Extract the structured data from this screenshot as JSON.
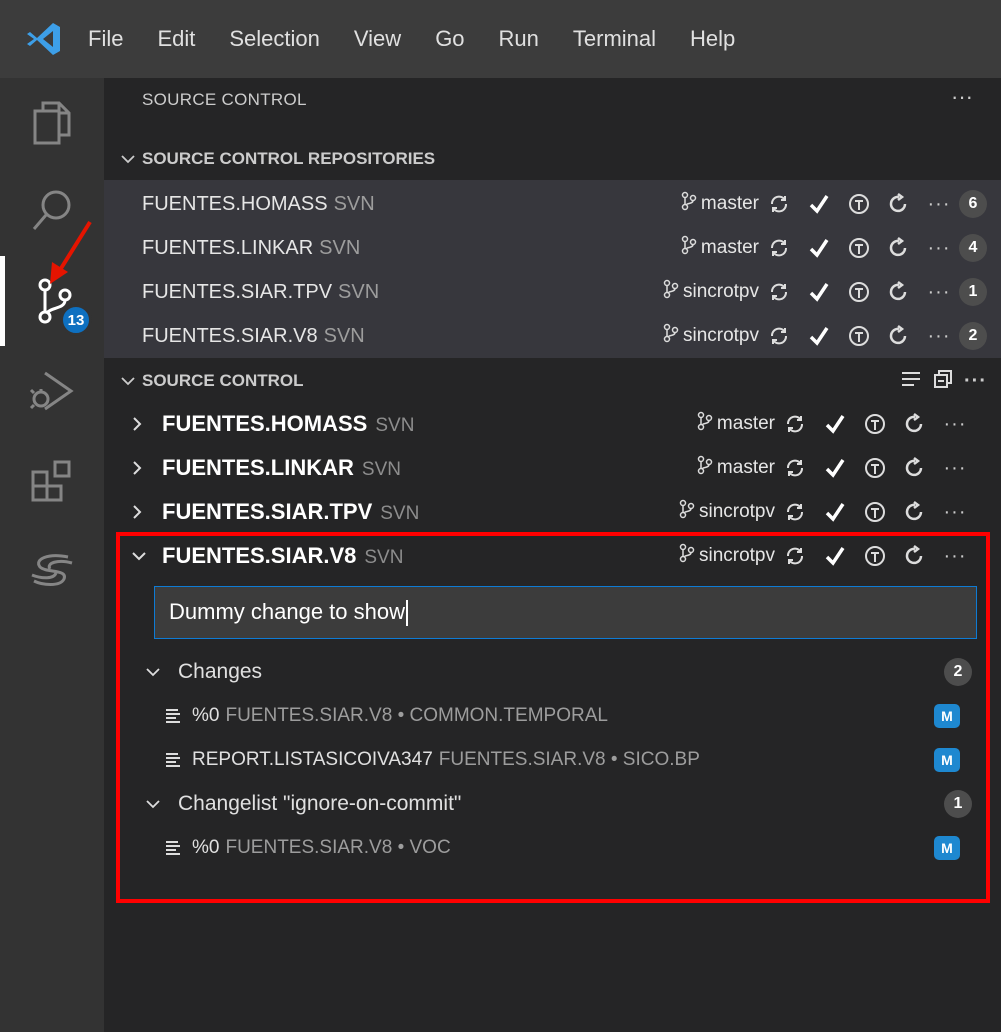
{
  "menu": [
    "File",
    "Edit",
    "Selection",
    "View",
    "Go",
    "Run",
    "Terminal",
    "Help"
  ],
  "activity": {
    "scm_badge": "13"
  },
  "sidebar": {
    "title": "SOURCE CONTROL",
    "more": "···",
    "repositories_header": "SOURCE CONTROL REPOSITORIES",
    "repositories": [
      {
        "name": "FUENTES.HOMASS",
        "type": "SVN",
        "branch": "master",
        "count": "6"
      },
      {
        "name": "FUENTES.LINKAR",
        "type": "SVN",
        "branch": "master",
        "count": "4"
      },
      {
        "name": "FUENTES.SIAR.TPV",
        "type": "SVN",
        "branch": "sincrotpv",
        "count": "1"
      },
      {
        "name": "FUENTES.SIAR.V8",
        "type": "SVN",
        "branch": "sincrotpv",
        "count": "2"
      }
    ],
    "source_control_header": "SOURCE CONTROL",
    "scm_repos": [
      {
        "name": "FUENTES.HOMASS",
        "type": "SVN",
        "branch": "master"
      },
      {
        "name": "FUENTES.LINKAR",
        "type": "SVN",
        "branch": "master"
      },
      {
        "name": "FUENTES.SIAR.TPV",
        "type": "SVN",
        "branch": "sincrotpv"
      },
      {
        "name": "FUENTES.SIAR.V8",
        "type": "SVN",
        "branch": "sincrotpv"
      }
    ],
    "commit_message": "Dummy change to show",
    "groups": [
      {
        "label": "Changes",
        "count": "2",
        "files": [
          {
            "name": "%0",
            "desc": "FUENTES.SIAR.V8 • COMMON.TEMPORAL",
            "status": "M"
          },
          {
            "name": "REPORT.LISTASICOIVA347",
            "desc": "FUENTES.SIAR.V8 • SICO.BP",
            "status": "M"
          }
        ]
      },
      {
        "label": "Changelist \"ignore-on-commit\"",
        "count": "1",
        "files": [
          {
            "name": "%0",
            "desc": "FUENTES.SIAR.V8 • VOC",
            "status": "M"
          }
        ]
      }
    ]
  },
  "colors": {
    "accent": "#0e70c0",
    "highlight": "#ff0000",
    "m_badge": "#1e88d0"
  }
}
